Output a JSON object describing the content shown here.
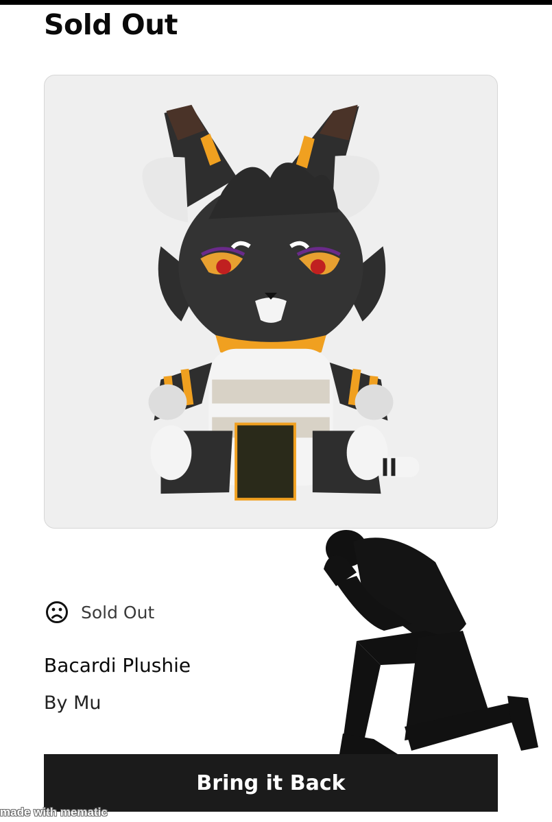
{
  "header": {
    "title": "Sold Out"
  },
  "product": {
    "image_subject": "plushie-cat",
    "status_icon": "sad-face-icon",
    "status_text": "Sold Out",
    "name": "Bacardi Plushie",
    "author": "By Mu"
  },
  "cta": {
    "label": "Bring it Back"
  },
  "overlay": {
    "subject": "kneeling-man-silhouette"
  },
  "watermark": {
    "text": "made with mematic"
  },
  "colors": {
    "plush_black": "#2e2e2e",
    "plush_orange": "#f0a020",
    "plush_white": "#f4f4f4",
    "button_bg": "#1b1b1b",
    "card_bg": "#efefef"
  }
}
